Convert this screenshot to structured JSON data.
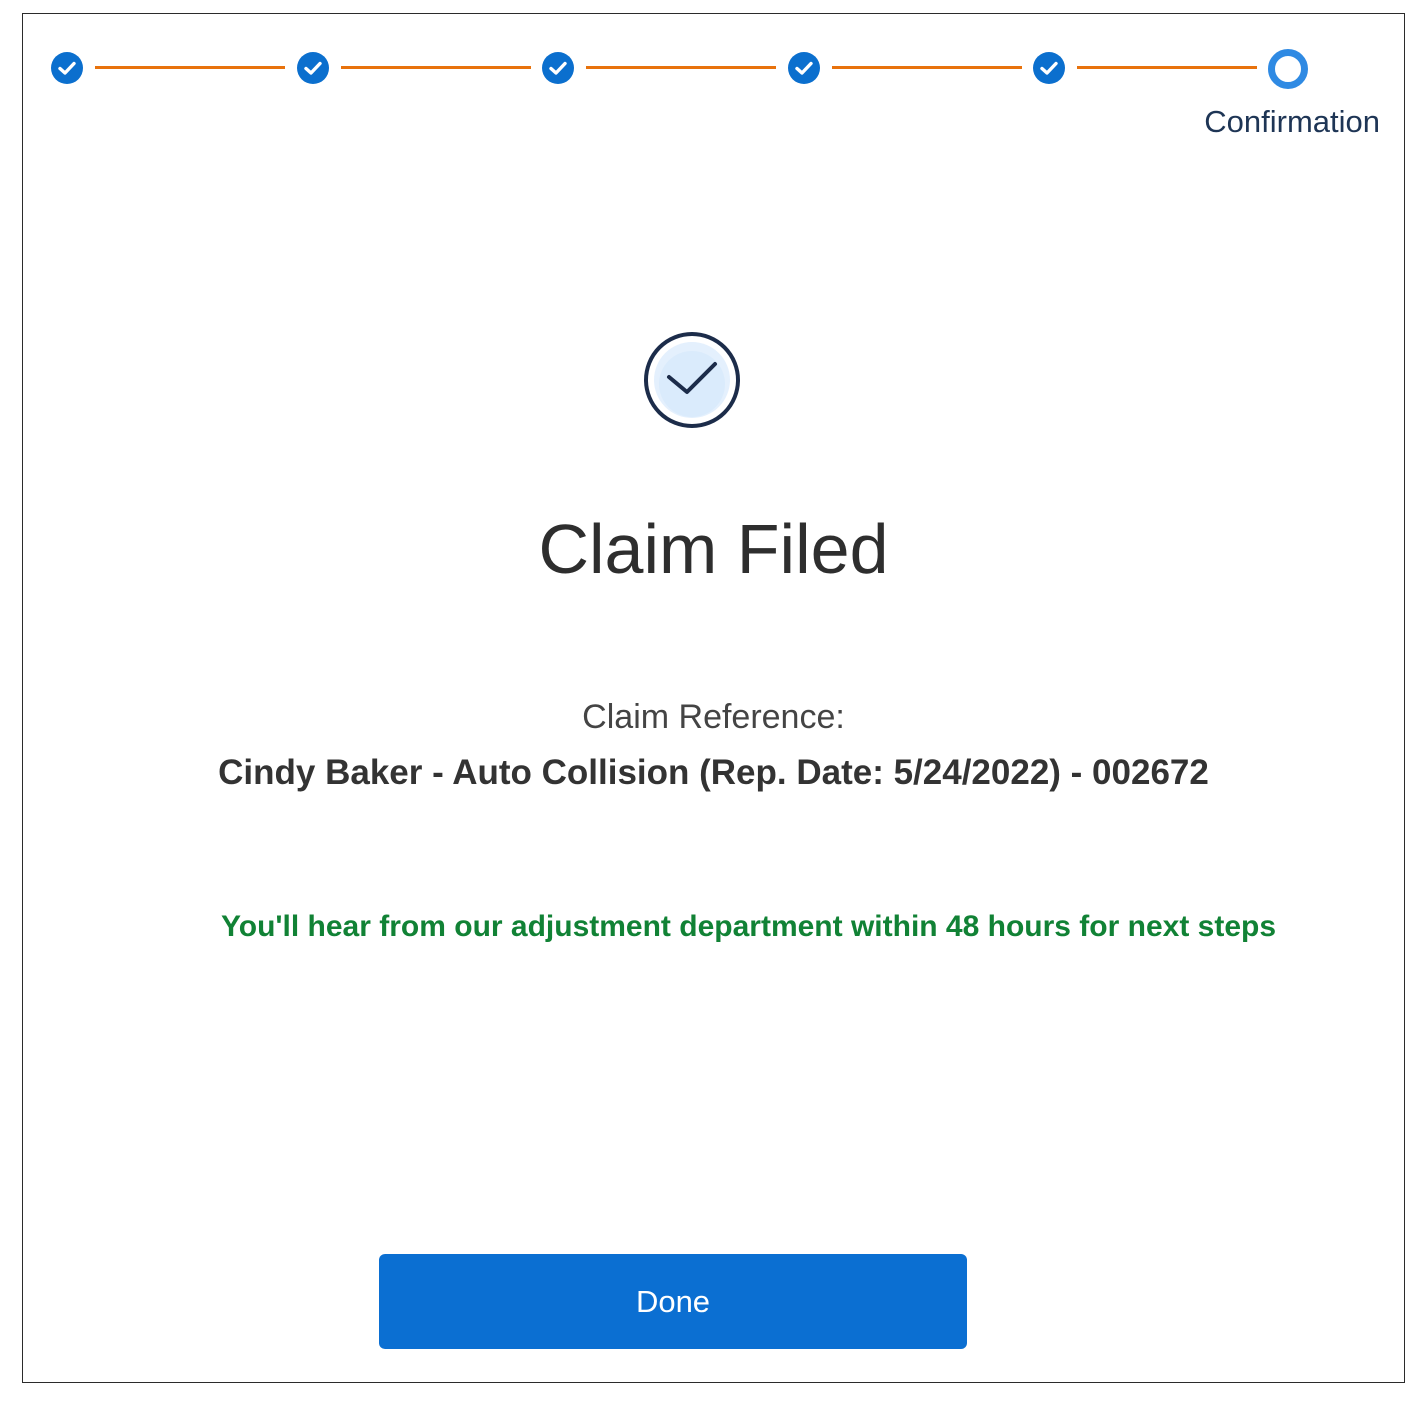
{
  "stepper": {
    "steps": [
      {
        "status": "completed",
        "icon": "check-icon"
      },
      {
        "status": "completed",
        "icon": "check-icon"
      },
      {
        "status": "completed",
        "icon": "check-icon"
      },
      {
        "status": "completed",
        "icon": "check-icon"
      },
      {
        "status": "completed",
        "icon": "check-icon"
      },
      {
        "status": "current",
        "label": "Confirmation"
      }
    ],
    "current_label": "Confirmation",
    "colors": {
      "completed": "#0b6fce",
      "current": "#2f8ae3",
      "connector": "#e8720c"
    }
  },
  "confirmation": {
    "icon": "circle-check-icon",
    "title": "Claim Filed",
    "reference_label": "Claim Reference:",
    "reference_value": "Cindy Baker - Auto Collision (Rep. Date: 5/24/2022) - 002672",
    "notice": "You'll hear from our adjustment department within 48 hours for next steps",
    "notice_color": "#118235"
  },
  "actions": {
    "done_label": "Done",
    "button_color": "#0b6fd2"
  }
}
